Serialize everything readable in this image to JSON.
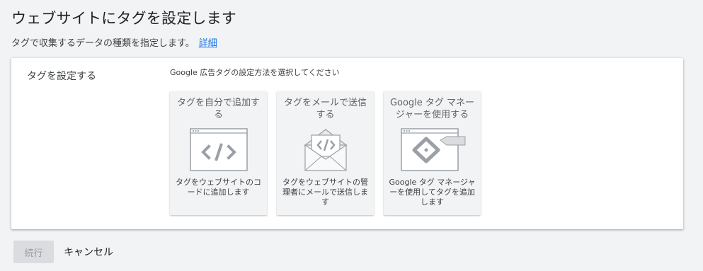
{
  "header": {
    "title": "ウェブサイトにタグを設定します",
    "subtitle": "タグで収集するデータの種類を指定します。",
    "learn_more": "詳細"
  },
  "card": {
    "section_label": "タグを設定する",
    "instruction": "Google 広告タグの設定方法を選択してください",
    "options": [
      {
        "title": "タグを自分で追加する",
        "description": "タグをウェブサイトのコードに追加します",
        "icon": "code-window-icon"
      },
      {
        "title": "タグをメールで送信する",
        "description": "タグをウェブサイトの管理者にメールで送信します",
        "icon": "email-code-icon"
      },
      {
        "title": "Google タグ マネージャーを使用する",
        "description": "Google タグ マネージャーを使用してタグを追加します",
        "icon": "tag-manager-icon"
      }
    ]
  },
  "footer": {
    "continue_label": "続行",
    "cancel_label": "キャンセル"
  }
}
